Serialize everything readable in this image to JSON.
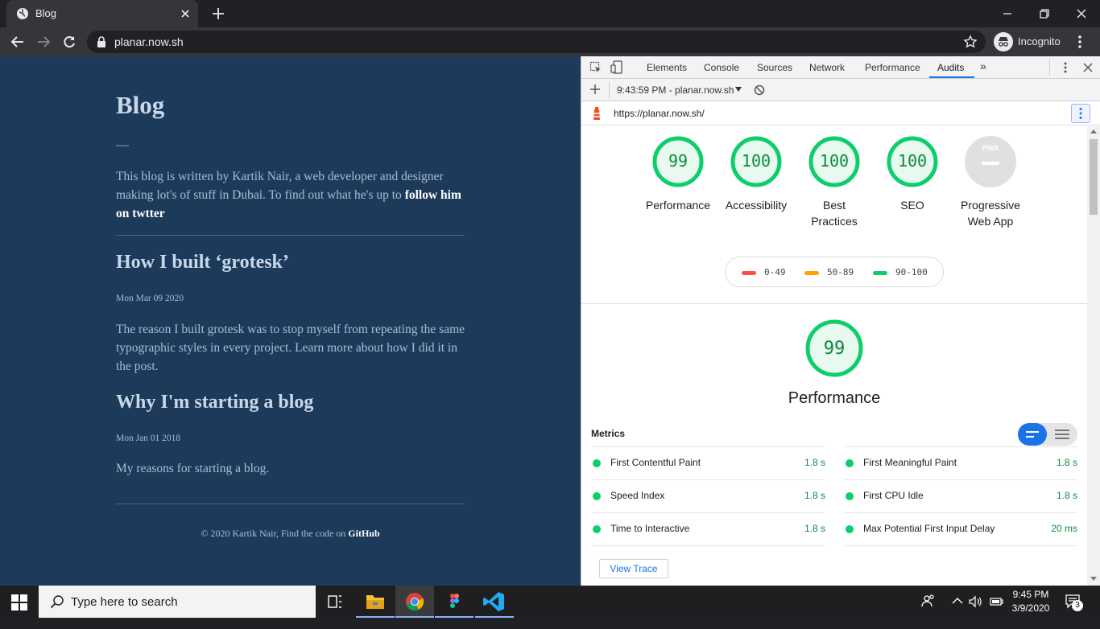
{
  "browser": {
    "tab_title": "Blog",
    "url": "planar.now.sh",
    "profile_label": "Incognito"
  },
  "blog": {
    "title": "Blog",
    "dash": "—",
    "intro_text": "This blog is written by Kartik Nair, a web developer and designer making lot's of stuff in Dubai. To find out what he's up to ",
    "intro_link": "follow him on twtter",
    "posts": [
      {
        "title": "How I built ‘grotesk’",
        "date": "Mon Mar 09 2020",
        "excerpt": "The reason I built grotesk was to stop myself from repeating the same typographic styles in every project. Learn more about how I did it in the post."
      },
      {
        "title": "Why I'm starting a blog",
        "date": "Mon Jan 01 2018",
        "excerpt": "My reasons for starting a blog."
      }
    ],
    "footer_text": "© 2020 Kartik Nair, Find the code on ",
    "footer_link": "GitHub"
  },
  "devtools": {
    "tabs": [
      "Elements",
      "Console",
      "Sources",
      "Network",
      "Performance",
      "Audits"
    ],
    "active_tab": "Audits",
    "more_tabs": "»",
    "report_selector": "9:43:59 PM - planar.now.sh",
    "audited_url": "https://planar.now.sh/",
    "scores": [
      {
        "label": "Performance",
        "value": "99"
      },
      {
        "label": "Accessibility",
        "value": "100"
      },
      {
        "label": "Best Practices",
        "value": "100"
      },
      {
        "label": "SEO",
        "value": "100"
      }
    ],
    "pwa": {
      "label": "Progressive Web App",
      "badge_text": "PWA"
    },
    "legend": [
      {
        "range": "0-49",
        "color": "#ff4e42"
      },
      {
        "range": "50-89",
        "color": "#ffa400"
      },
      {
        "range": "90-100",
        "color": "#0cce6b"
      }
    ],
    "performance": {
      "score": "99",
      "title": "Performance"
    },
    "metrics_header": "Metrics",
    "metrics": [
      {
        "name": "First Contentful Paint",
        "value": "1.8 s"
      },
      {
        "name": "First Meaningful Paint",
        "value": "1.8 s"
      },
      {
        "name": "Speed Index",
        "value": "1.8 s"
      },
      {
        "name": "First CPU Idle",
        "value": "1.8 s"
      },
      {
        "name": "Time to Interactive",
        "value": "1.8 s"
      },
      {
        "name": "Max Potential First Input Delay",
        "value": "20 ms"
      }
    ],
    "view_trace": "View Trace",
    "colors": {
      "pass": "#0cce6b",
      "pass_text": "#0a8a3c",
      "accent": "#1a73e8"
    }
  },
  "taskbar": {
    "search_placeholder": "Type here to search",
    "time": "9:45 PM",
    "date": "3/9/2020",
    "notification_count": "3"
  }
}
